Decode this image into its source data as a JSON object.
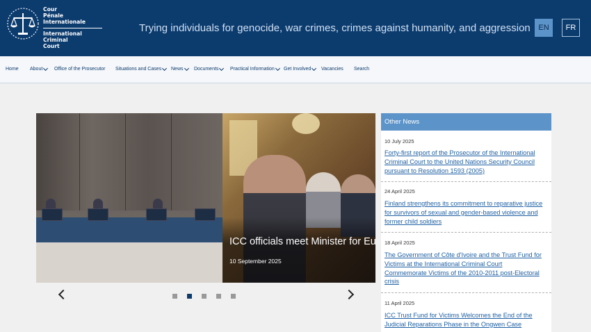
{
  "header": {
    "logo_lines_fr": [
      "Cour",
      "Pénale",
      "Internationale"
    ],
    "logo_lines_en": [
      "International",
      "Criminal",
      "Court"
    ],
    "tagline": "Trying individuals for genocide, war crimes, crimes against humanity, and aggression",
    "lang_en": "EN",
    "lang_fr": "FR"
  },
  "nav": {
    "items": [
      {
        "label": "Home"
      },
      {
        "label": "About"
      },
      {
        "label": "Office of the Prosecutor"
      },
      {
        "label": "Situations and Cases"
      },
      {
        "label": "News"
      },
      {
        "label": "Documents"
      },
      {
        "label": "Practical Information"
      },
      {
        "label": "Get Involved"
      },
      {
        "label": "Vacancies"
      },
      {
        "label": "Search"
      }
    ]
  },
  "carousel": {
    "caption_title": "ICC officials meet Minister for Eu",
    "caption_date": "10 September 2025",
    "dots": 5,
    "active_dot": 2
  },
  "other_news": {
    "heading": "Other News",
    "items": [
      {
        "date": "10 July 2025",
        "title": "Forty-first report of the Prosecutor of the International Criminal Court to the United Nations Security Council pursuant to Resolution 1593 (2005)"
      },
      {
        "date": "24 April 2025",
        "title": "Finland strengthens its commitment to reparative justice for survivors of sexual and gender-based violence and former child soldiers"
      },
      {
        "date": "18 April 2025",
        "title": "The Government of Côte d'Ivoire and the Trust Fund for Victims at the International Criminal Court Commemorate Victims of the 2010-2011 post-Electoral crisis"
      },
      {
        "date": "11 April 2025",
        "title": "ICC Trust Fund for Victims Welcomes the End of the Judicial Reparations Phase in the Ongwen Case"
      }
    ]
  },
  "colors": {
    "header_bg": "#0c3b6e",
    "accent": "#5c93c9",
    "link": "#1d5fa3"
  }
}
